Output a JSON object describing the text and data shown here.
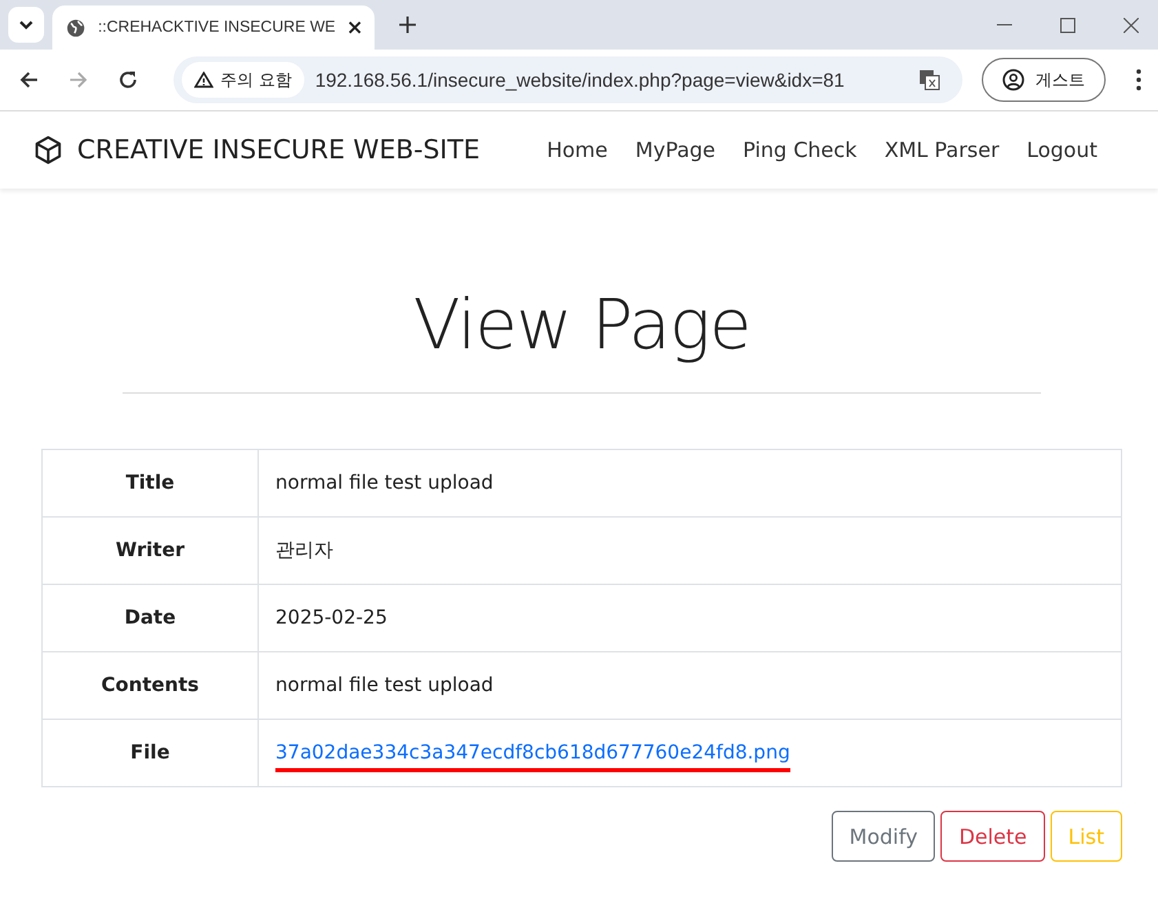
{
  "browser": {
    "tab_title": "::CREHACKTIVE INSECURE WE",
    "security_label": "주의 요함",
    "url": "192.168.56.1/insecure_website/index.php?page=view&idx=81",
    "profile_label": "게스트"
  },
  "navbar": {
    "brand": "CREATIVE INSECURE WEB-SITE",
    "links": [
      "Home",
      "MyPage",
      "Ping Check",
      "XML Parser",
      "Logout"
    ]
  },
  "heading": "View Page",
  "table": {
    "rows": [
      {
        "label": "Title",
        "value": "normal file test upload",
        "kind": "text"
      },
      {
        "label": "Writer",
        "value": "관리자",
        "kind": "text"
      },
      {
        "label": "Date",
        "value": "2025-02-25",
        "kind": "text"
      },
      {
        "label": "Contents",
        "value": "normal file test upload",
        "kind": "text"
      },
      {
        "label": "File",
        "value": "37a02dae334c3a347ecdf8cb618d677760e24fd8.png",
        "kind": "link",
        "underlined": true
      }
    ]
  },
  "buttons": [
    {
      "label": "Modify",
      "kind": "secondary"
    },
    {
      "label": "Delete",
      "kind": "danger"
    },
    {
      "label": "List",
      "kind": "warning"
    }
  ]
}
